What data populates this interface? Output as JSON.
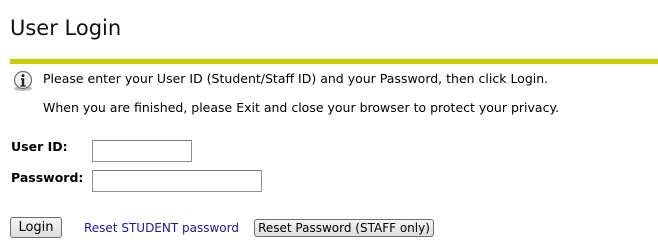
{
  "page": {
    "title": "User Login"
  },
  "instructions": {
    "icon": "info-icon",
    "line1": "Please enter your User ID (Student/Staff ID) and your Password, then click Login.",
    "line2": "When you are finished, please Exit and close your browser to protect your privacy."
  },
  "form": {
    "userid_label": "User ID:",
    "userid_value": "",
    "password_label": "Password:",
    "password_value": ""
  },
  "actions": {
    "login_label": "Login",
    "reset_student_label": "Reset STUDENT password",
    "reset_staff_label": "Reset Password (STAFF only)"
  },
  "colors": {
    "rule": "#cccc00",
    "link": "#1a1aa6"
  }
}
